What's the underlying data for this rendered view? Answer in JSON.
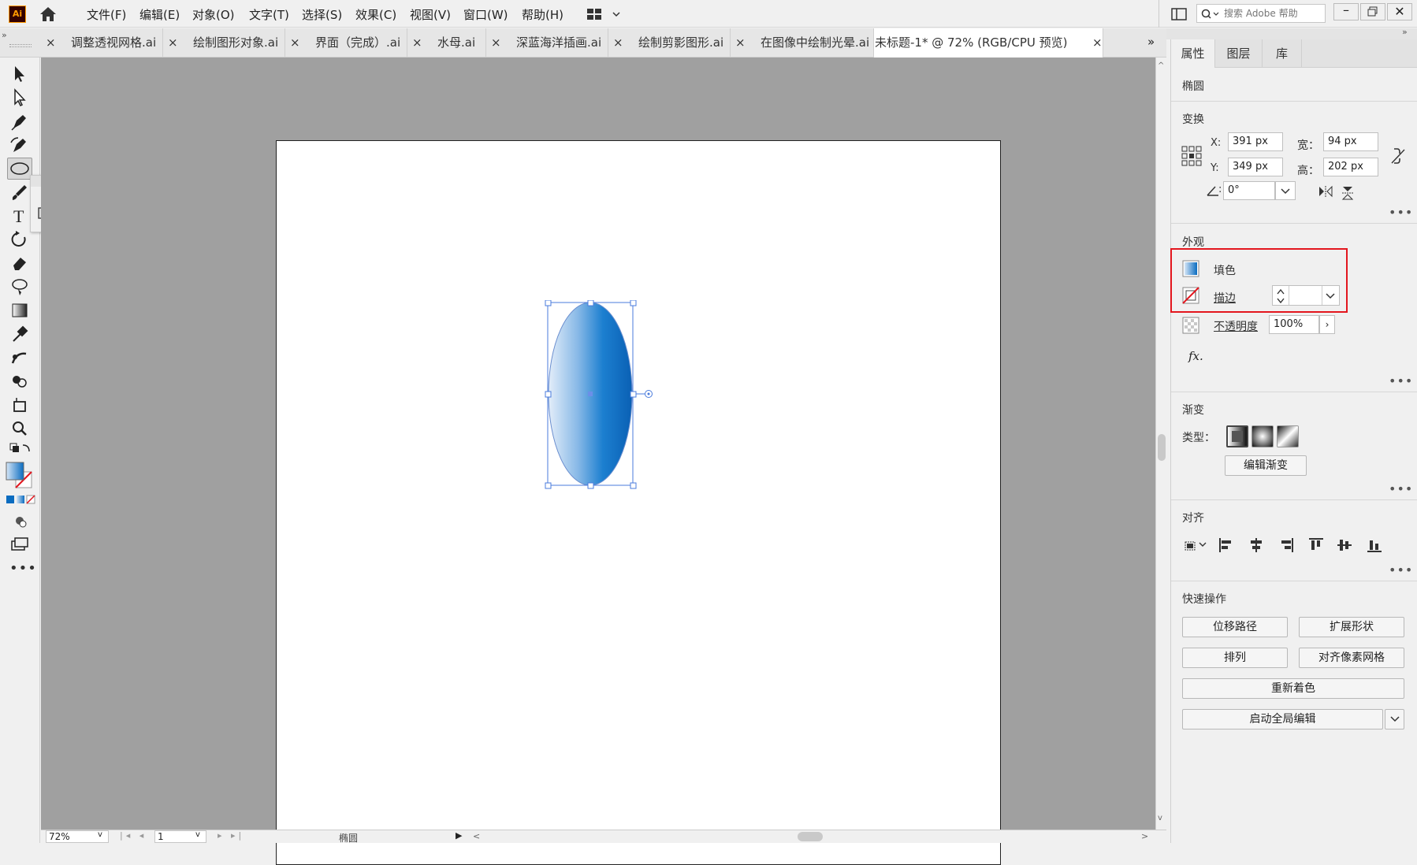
{
  "app": {
    "logo": "Ai"
  },
  "menu": [
    "文件(F)",
    "编辑(E)",
    "对象(O)",
    "文字(T)",
    "选择(S)",
    "效果(C)",
    "视图(V)",
    "窗口(W)",
    "帮助(H)"
  ],
  "search": {
    "placeholder": "搜索 Adobe 帮助"
  },
  "tabs": [
    {
      "label": "调整透视网格.ai"
    },
    {
      "label": "绘制图形对象.ai"
    },
    {
      "label": "界面（完成）.ai"
    },
    {
      "label": "水母.ai"
    },
    {
      "label": "深蓝海洋插画.ai"
    },
    {
      "label": "绘制剪影图形.ai"
    },
    {
      "label": "在图像中绘制光晕.ai"
    },
    {
      "label": "未标题-1* @ 72% (RGB/CPU 预览)",
      "active": true
    }
  ],
  "panel": {
    "tabs": [
      "属性",
      "图层",
      "库"
    ],
    "object_type": "椭圆",
    "transform": {
      "title": "变换",
      "x_label": "X:",
      "x": "391 px",
      "y_label": "Y:",
      "y": "349 px",
      "w_label": "宽：",
      "w": "94 px",
      "h_label": "高：",
      "h": "202 px",
      "angle": "0°"
    },
    "appearance": {
      "title": "外观",
      "fill_label": "填色",
      "stroke_label": "描边",
      "opacity_label": "不透明度",
      "opacity": "100%",
      "fx": "fx."
    },
    "gradient": {
      "title": "渐变",
      "type_label": "类型：",
      "edit_button": "编辑渐变"
    },
    "align": {
      "title": "对齐"
    },
    "quick_actions": {
      "title": "快速操作",
      "offset_path": "位移路径",
      "expand_shape": "扩展形状",
      "arrange": "排列",
      "pixel_grid": "对齐像素网格",
      "recolor": "重新着色",
      "global_edit": "启动全局编辑"
    }
  },
  "status": {
    "zoom": "72%",
    "page": "1",
    "object_type": "椭圆"
  },
  "colors": {
    "accent": "#e3161e",
    "gradient_start": "#d6e6f7",
    "gradient_end": "#0a6cc0",
    "selection": "#4a7bdc"
  }
}
